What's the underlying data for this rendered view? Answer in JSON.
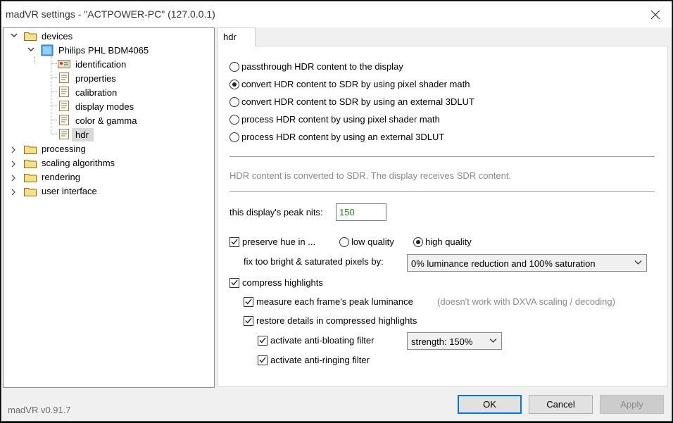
{
  "window": {
    "title": "madVR settings - \"ACTPOWER-PC\" (127.0.0.1)",
    "close_icon": "close-icon"
  },
  "tree": {
    "devices": "devices",
    "display": "Philips PHL BDM4065",
    "identification": "identification",
    "properties": "properties",
    "calibration": "calibration",
    "display_modes": "display modes",
    "color_gamma": "color & gamma",
    "hdr": "hdr",
    "processing": "processing",
    "scaling_algorithms": "scaling algorithms",
    "rendering": "rendering",
    "user_interface": "user interface",
    "selected": "hdr"
  },
  "tab": {
    "label": "hdr"
  },
  "hdr": {
    "modes": [
      {
        "label": "passthrough HDR content to the display",
        "selected": false
      },
      {
        "label": "convert HDR content to SDR by using pixel shader math",
        "selected": true
      },
      {
        "label": "convert HDR content to SDR by using an external 3DLUT",
        "selected": false
      },
      {
        "label": "process HDR content by using pixel shader math",
        "selected": false
      },
      {
        "label": "process HDR content by using an external 3DLUT",
        "selected": false
      }
    ],
    "info": "HDR content is converted to SDR. The display receives SDR content.",
    "peak_nits_label": "this display's peak nits:",
    "peak_nits_value": "150",
    "preserve_hue_label": "preserve hue in ...",
    "preserve_hue_checked": true,
    "low_quality": "low quality",
    "high_quality": "high quality",
    "quality_selected": "high quality",
    "fix_label": "fix too bright & saturated pixels by:",
    "fix_value": "0% luminance reduction and 100% saturation",
    "compress_highlights": "compress highlights",
    "measure_peak": "measure each frame's peak luminance",
    "measure_note": "(doesn't work with DXVA scaling / decoding)",
    "restore_details": "restore details in compressed highlights",
    "anti_bloating": "activate anti-bloating filter",
    "strength_value": "strength: 150%",
    "anti_ringing": "activate anti-ringing filter"
  },
  "footer": {
    "version": "madVR v0.91.7",
    "ok": "OK",
    "cancel": "Cancel",
    "apply": "Apply"
  },
  "colors": {
    "accent": "#0078d7",
    "nits_text": "#1d8a1d",
    "info_text": "#8a8a8a"
  }
}
